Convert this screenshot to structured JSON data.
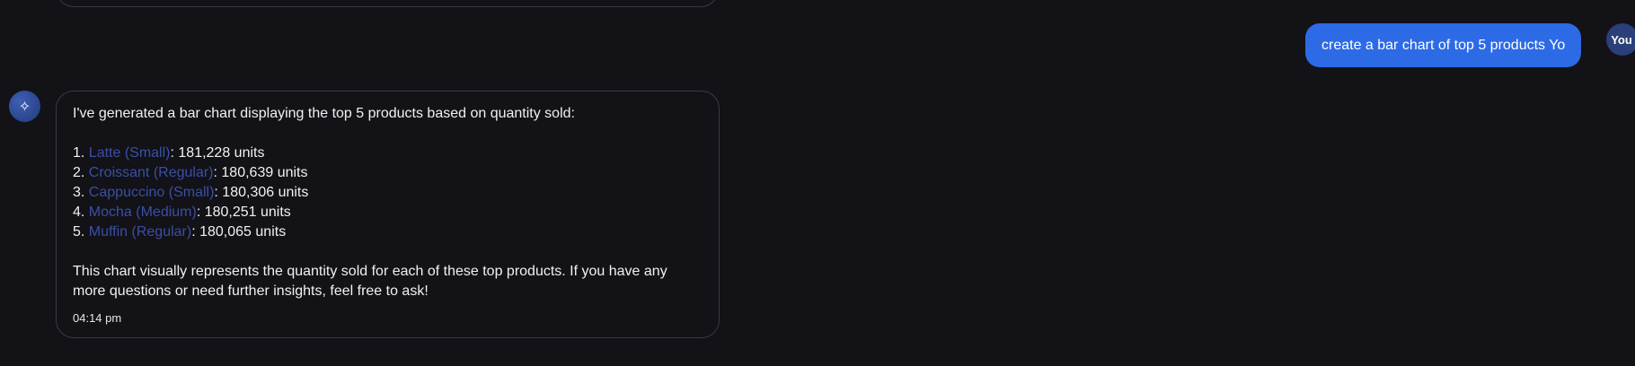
{
  "user_message": {
    "text": "create a bar chart of top 5 products Yo",
    "avatar_label": "You"
  },
  "assistant_message": {
    "intro": "I've generated a bar chart displaying the top 5 products based on quantity sold:",
    "items": [
      {
        "number": "1.",
        "product": "Latte (Small)",
        "value": ": 181,228 units"
      },
      {
        "number": "2.",
        "product": "Croissant (Regular)",
        "value": ": 180,639 units"
      },
      {
        "number": "3.",
        "product": "Cappuccino (Small)",
        "value": ": 180,306 units"
      },
      {
        "number": "4.",
        "product": "Mocha (Medium)",
        "value": ": 180,251 units"
      },
      {
        "number": "5.",
        "product": "Muffin (Regular)",
        "value": ": 180,065 units"
      }
    ],
    "outro": "This chart visually represents the quantity sold for each of these top products. If you have any more questions or need further insights, feel free to ask!",
    "timestamp": "04:14 pm",
    "avatar_icon": "sparkle-icon"
  },
  "colors": {
    "background": "#121217",
    "user_bubble": "#2d6ae6",
    "link": "#3a4fa6",
    "border": "#3a3a44"
  }
}
